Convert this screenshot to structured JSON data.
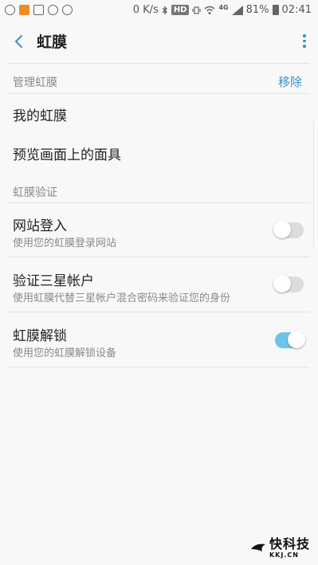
{
  "status_bar": {
    "network_speed": "0 K/s",
    "hd_badge": "HD",
    "network_type": "4G",
    "battery_percent": "81%",
    "time": "02:41",
    "icons": [
      "settings-icon",
      "notification-app-icon",
      "image-icon",
      "chat-app-icon",
      "sync-icon",
      "bluetooth-icon",
      "vibrate-icon",
      "wifi-icon",
      "signal-icon",
      "battery-icon"
    ]
  },
  "app_bar": {
    "title": "虹膜",
    "back_icon": "back-arrow-icon",
    "more_icon": "more-vertical-icon"
  },
  "manage_section": {
    "header": "管理虹膜",
    "action": "移除",
    "items": [
      {
        "title": "我的虹膜"
      },
      {
        "title": "预览画面上的面具"
      }
    ]
  },
  "verify_section": {
    "header": "虹膜验证",
    "items": [
      {
        "title": "网站登入",
        "subtitle": "使用您的虹膜登录网站",
        "enabled": false
      },
      {
        "title": "验证三星帐户",
        "subtitle": "使用虹膜代替三星帐户混合密码来验证您的身份",
        "enabled": false
      },
      {
        "title": "虹膜解锁",
        "subtitle": "使用您的虹膜解锁设备",
        "enabled": true
      }
    ]
  },
  "colors": {
    "accent": "#3a8fc4",
    "switch_on": "#6cc5e7",
    "switch_off": "#dcdcdc",
    "background": "#f8f8f8"
  },
  "watermark": {
    "main": "快科技",
    "sub": "KKJ.CN"
  }
}
